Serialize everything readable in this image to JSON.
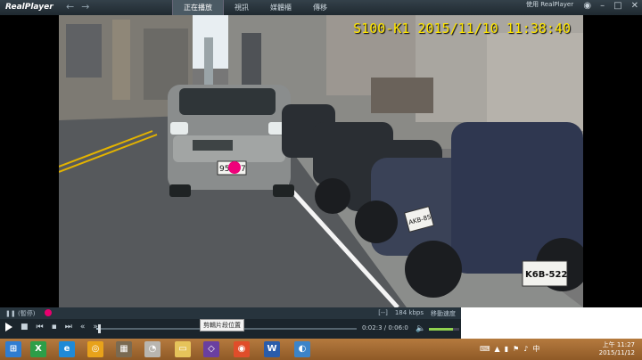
{
  "titlebar": {
    "logo": "RealPlayer",
    "logo_sub": "",
    "tabs": [
      "正在播放",
      "視訊",
      "媒體櫃",
      "傳移"
    ],
    "brand_line1": "使用 RealPlayer",
    "brand_line2": ""
  },
  "video": {
    "osd_text": "S100-K1 2015/11/10 11:38:40",
    "plate_front": "95",
    "plate_front2": "7",
    "plate_right1": "AKB-85",
    "plate_right2": "K6B-522"
  },
  "controls": {
    "status_left": "(暫停)",
    "status_right1": "[--]",
    "status_right2": "184 kbps",
    "status_right3": "移動速度",
    "tooltip": "剪輯片段位置",
    "time": "0:02:3 / 0:06:0",
    "progress_fraction": 0.01,
    "volume_fraction": 0.8
  },
  "taskbar": {
    "clock_time": "上午 11:27",
    "clock_date": "2015/11/12",
    "ime": "中"
  },
  "colors": {
    "osd": "#ffe600",
    "taskbar": "#a56d35"
  }
}
